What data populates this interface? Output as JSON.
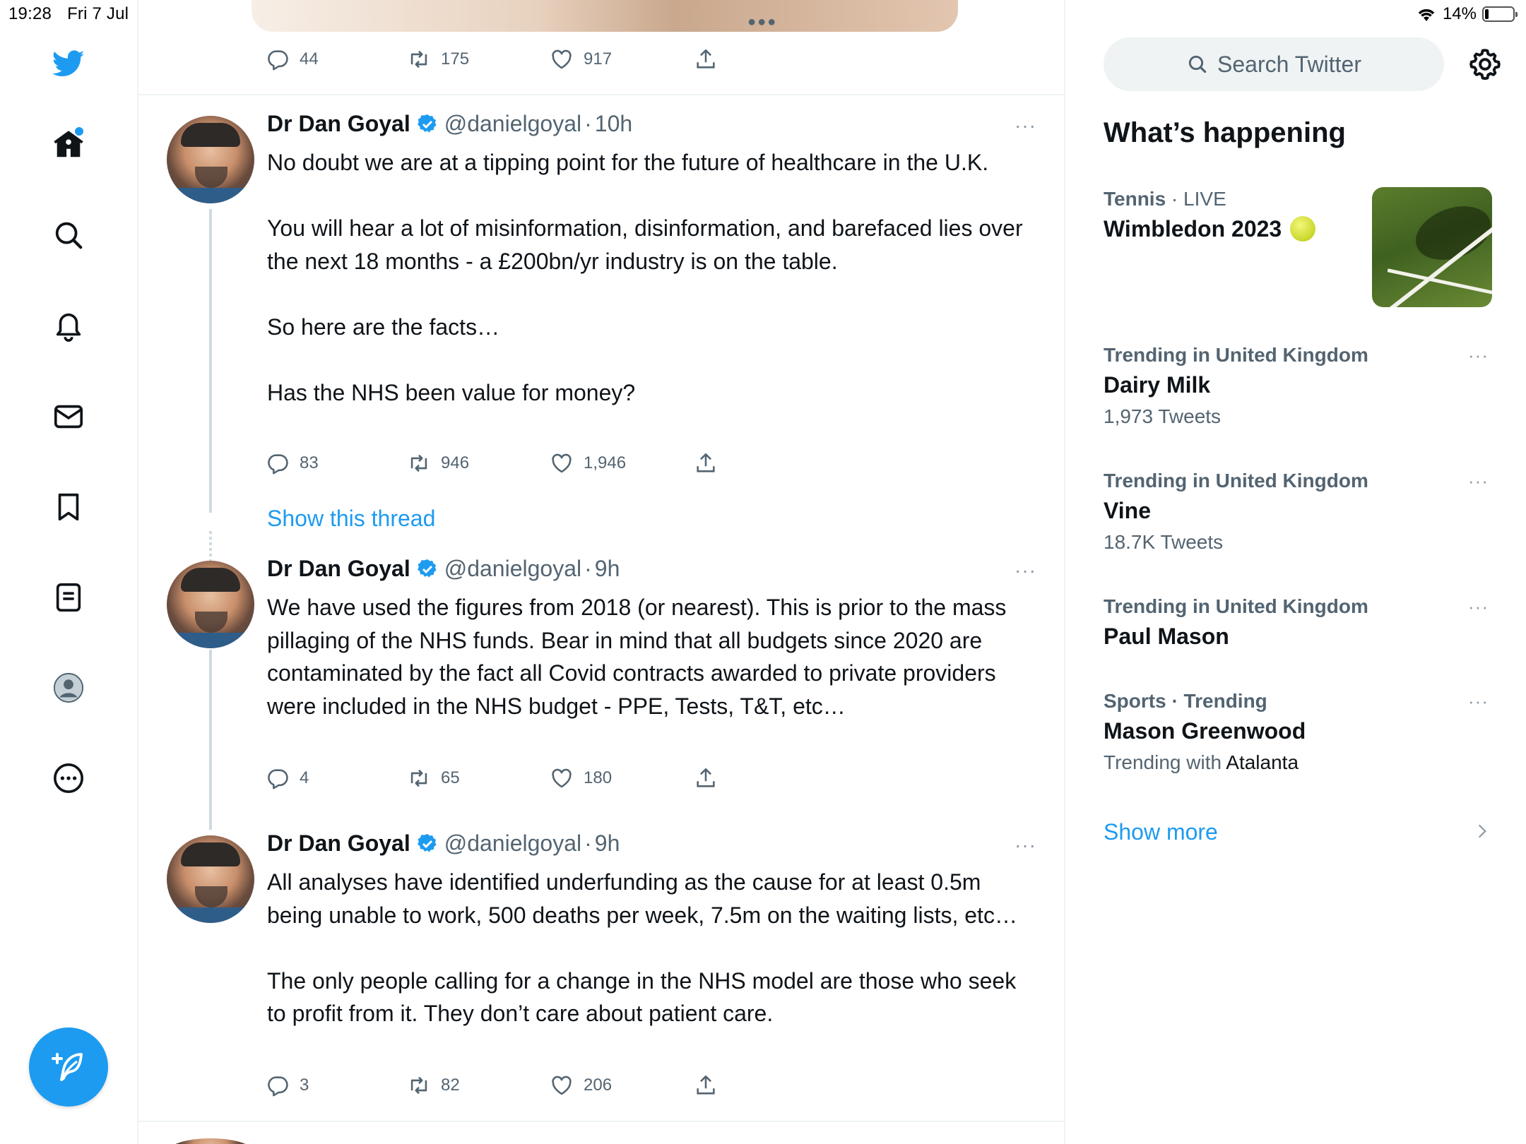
{
  "status_bar": {
    "time": "19:28",
    "date": "Fri 7 Jul",
    "battery": "14%",
    "battery_level": 0.14
  },
  "nav": {
    "items": [
      "twitter-logo",
      "home-icon",
      "search-icon",
      "bell-icon",
      "mail-icon",
      "bookmark-icon",
      "lists-icon",
      "profile-icon",
      "more-icon"
    ],
    "home_has_notification": true,
    "compose": "compose-icon"
  },
  "top_tweet_actions": {
    "replies": "44",
    "retweets": "175",
    "likes": "917"
  },
  "tweets": [
    {
      "name": "Dr Dan Goyal",
      "handle": "@danielgoyal",
      "sep": "·",
      "time": "10h",
      "paragraphs": [
        "No doubt we are at a tipping point for the future of healthcare in the U.K.",
        "You will hear a lot of misinformation, disinformation, and barefaced lies over the next 18 months - a £200bn/yr industry is on the table.",
        "So here are the facts…",
        "Has the NHS been value for money?"
      ],
      "replies": "83",
      "retweets": "946",
      "likes": "1,946"
    },
    {
      "name": "Dr Dan Goyal",
      "handle": "@danielgoyal",
      "sep": "·",
      "time": "9h",
      "paragraphs": [
        "We have used the figures from 2018 (or nearest). This is prior to the mass pillaging of the NHS funds.  Bear in mind that all budgets since 2020 are contaminated by the fact all Covid contracts awarded to private providers were included in the NHS budget - PPE, Tests, T&T, etc…"
      ],
      "replies": "4",
      "retweets": "65",
      "likes": "180"
    },
    {
      "name": "Dr Dan Goyal",
      "handle": "@danielgoyal",
      "sep": "·",
      "time": "9h",
      "paragraphs": [
        "All analyses have identified underfunding as the cause for at least 0.5m being unable to work, 500 deaths per week, 7.5m on the waiting lists, etc…",
        "The only people calling for a change in the NHS model are those who seek to profit from it. They don’t care about patient care."
      ],
      "replies": "3",
      "retweets": "82",
      "likes": "206"
    }
  ],
  "show_thread": "Show this thread",
  "more_dots": "···",
  "sidebar": {
    "search_placeholder": "Search Twitter",
    "title": "What’s happening",
    "trends": [
      {
        "ctx_bold": "Tennis",
        "ctx_rest": " · LIVE",
        "title": "Wimbledon 2023",
        "meta": "",
        "meta_with": "",
        "has_image": true
      },
      {
        "ctx_bold": "Trending in United Kingdom",
        "ctx_rest": "",
        "title": "Dairy Milk",
        "meta": "1,973 Tweets",
        "meta_with": ""
      },
      {
        "ctx_bold": "Trending in United Kingdom",
        "ctx_rest": "",
        "title": "Vine",
        "meta": "18.7K Tweets",
        "meta_with": ""
      },
      {
        "ctx_bold": "Trending in United Kingdom",
        "ctx_rest": "",
        "title": "Paul Mason",
        "meta": "",
        "meta_with": ""
      },
      {
        "ctx_bold": "Sports · Trending",
        "ctx_rest": "",
        "title": "Mason Greenwood",
        "meta": "Trending with ",
        "meta_with": "Atalanta"
      }
    ],
    "show_more": "Show more"
  },
  "colors": {
    "accent": "#1d9bf0",
    "secondary_text": "#536471",
    "primary_text": "#0f1419",
    "border": "#eff3f4"
  }
}
